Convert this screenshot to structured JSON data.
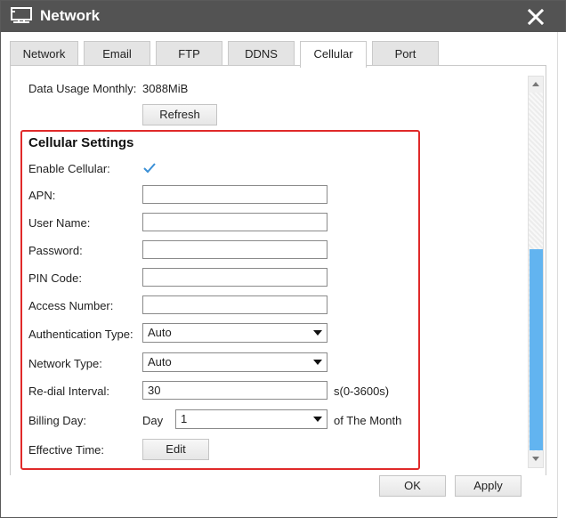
{
  "window": {
    "title": "Network",
    "close_glyph": "✕"
  },
  "tabs": [
    {
      "label": "Network"
    },
    {
      "label": "Email"
    },
    {
      "label": "FTP"
    },
    {
      "label": "DDNS"
    },
    {
      "label": "Cellular"
    },
    {
      "label": "Port"
    }
  ],
  "active_tab": "Cellular",
  "data_usage": {
    "label": "Data Usage Monthly:",
    "value": "3088MiB",
    "refresh_label": "Refresh"
  },
  "cellular": {
    "section_title": "Cellular Settings",
    "enable_label": "Enable Cellular:",
    "enable_checked": true,
    "apn_label": "APN:",
    "apn_value": "",
    "username_label": "User Name:",
    "username_value": "",
    "password_label": "Password:",
    "password_value": "",
    "pin_label": "PIN Code:",
    "pin_value": "",
    "access_label": "Access Number:",
    "access_value": "",
    "auth_label": "Authentication Type:",
    "auth_value": "Auto",
    "network_type_label": "Network Type:",
    "network_type_value": "Auto",
    "redial_label": "Re-dial Interval:",
    "redial_value": "30",
    "redial_unit": "s(0-3600s)",
    "billing_label": "Billing Day:",
    "billing_prefix": "Day",
    "billing_value": "1",
    "billing_suffix": "of The Month",
    "effective_label": "Effective Time:",
    "edit_label": "Edit"
  },
  "footer": {
    "ok_label": "OK",
    "apply_label": "Apply"
  },
  "colors": {
    "titlebar": "#535353",
    "highlight": "#e02a2a",
    "scroll_thumb": "#62b4f0",
    "check": "#3a8fd6"
  },
  "icons": {
    "title_icon": "network-monitor-icon",
    "close": "close-icon"
  }
}
